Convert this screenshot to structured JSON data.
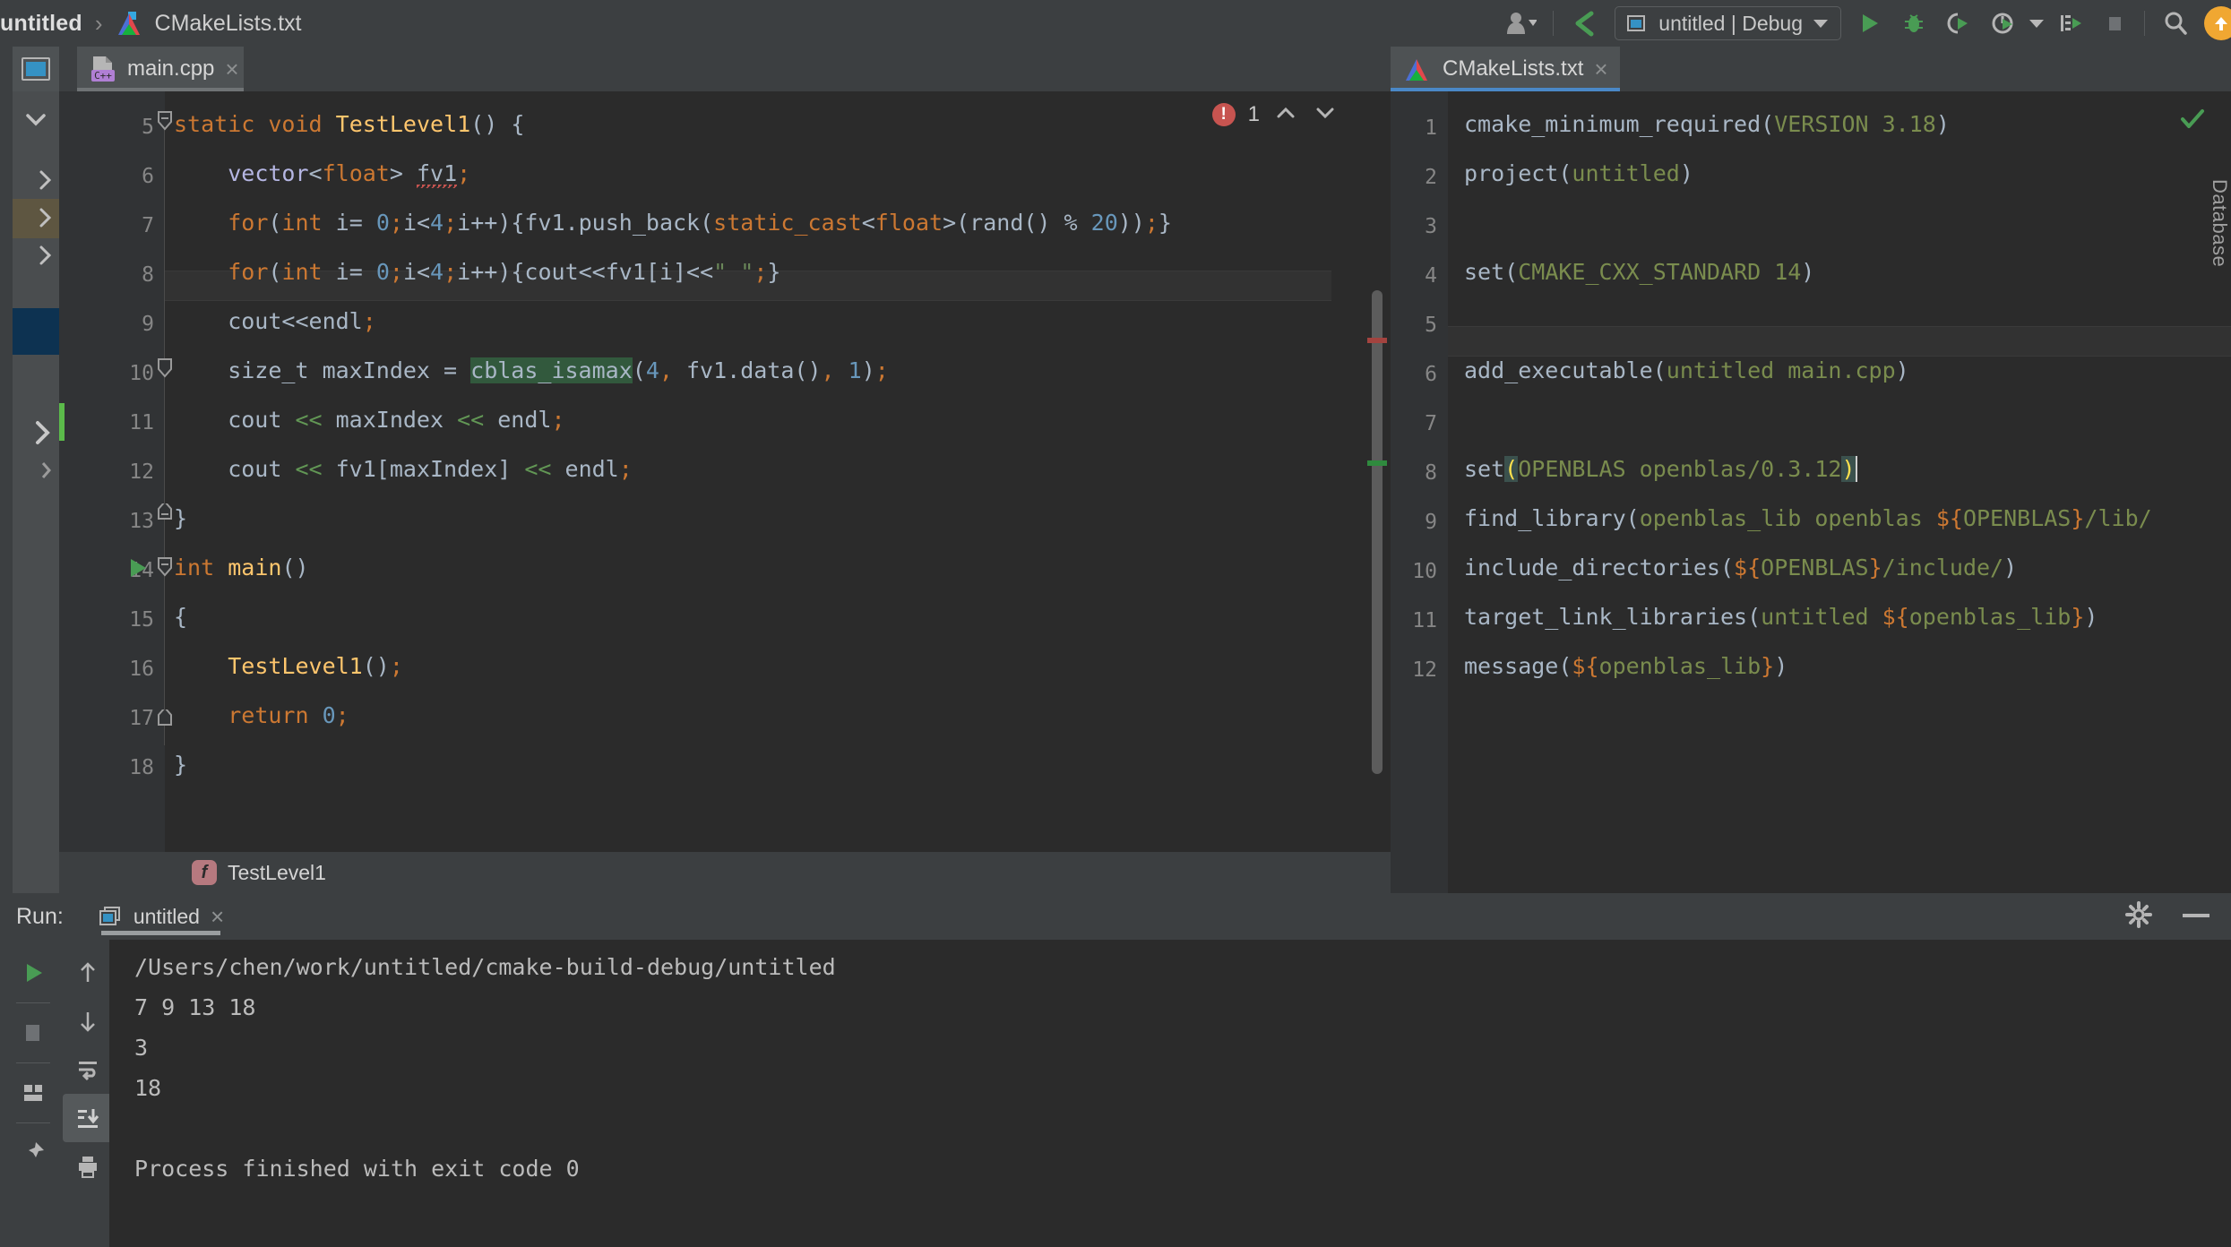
{
  "breadcrumb": {
    "project": "untitled",
    "separator": "›",
    "file": "CMakeLists.txt"
  },
  "toolbar": {
    "user_icon": "user-avatar-icon",
    "vcs_update_icon": "vcs-update-icon",
    "run_config": "untitled | Debug",
    "run_icon": "run-icon",
    "debug_icon": "debug-icon",
    "attach_icon": "attach-to-process-icon",
    "profile_icon": "profile-icon",
    "coverage_icon": "run-with-coverage-icon",
    "stop_icon": "stop-icon",
    "search_icon": "search-everywhere-icon",
    "update_badge_icon": "ide-update-icon"
  },
  "tabs": {
    "left": {
      "label": "main.cpp",
      "icon": "cpp-file-icon",
      "close": "×",
      "active": false
    },
    "right": {
      "label": "CMakeLists.txt",
      "icon": "cmake-file-icon",
      "close": "×",
      "active": true,
      "underline_color": "#4a88c7"
    }
  },
  "editor_cpp": {
    "line_numbers": [
      "5",
      "6",
      "7",
      "8",
      "9",
      "10",
      "11",
      "12",
      "13",
      "14",
      "15",
      "16",
      "17",
      "18"
    ],
    "inspection": {
      "error_icon": "error-icon",
      "error_count": "1",
      "prev_icon": "chevron-up-icon",
      "next_icon": "chevron-down-icon"
    },
    "lines": [
      {
        "n": "5",
        "text": "static void TestLevel1() {"
      },
      {
        "n": "6",
        "text": "    vector<float> fv1;"
      },
      {
        "n": "7",
        "text": "    for(int i= 0;i<4;i++){fv1.push_back(static_cast<float>(rand() % 20));}"
      },
      {
        "n": "8",
        "text": "    for(int i= 0;i<4;i++){cout<<fv1[i]<<\" \";}"
      },
      {
        "n": "9",
        "text": "    cout<<endl;"
      },
      {
        "n": "10",
        "text": "    size_t maxIndex = cblas_isamax(4, fv1.data(), 1);"
      },
      {
        "n": "11",
        "text": "    cout << maxIndex << endl;"
      },
      {
        "n": "12",
        "text": "    cout << fv1[maxIndex] << endl;"
      },
      {
        "n": "13",
        "text": "}"
      },
      {
        "n": "14",
        "text": "int main()"
      },
      {
        "n": "15",
        "text": "{"
      },
      {
        "n": "16",
        "text": "    TestLevel1();"
      },
      {
        "n": "17",
        "text": "    return 0;"
      },
      {
        "n": "18",
        "text": "}"
      }
    ],
    "gutter": {
      "run_arrow_icon": "run-gutter-icon",
      "fold_icon": "fold-collapse-icon"
    },
    "breadcrumb": {
      "badge": "f",
      "symbol": "TestLevel1"
    }
  },
  "editor_cmake": {
    "status_icon": "inspections-ok-icon",
    "line_numbers": [
      "1",
      "2",
      "3",
      "4",
      "5",
      "6",
      "7",
      "8",
      "9",
      "10",
      "11",
      "12"
    ],
    "lines": [
      {
        "n": "1",
        "cmd": "cmake_minimum_required",
        "args": "VERSION 3.18"
      },
      {
        "n": "2",
        "cmd": "project",
        "args": "untitled"
      },
      {
        "n": "3",
        "cmd": "",
        "args": ""
      },
      {
        "n": "4",
        "cmd": "set",
        "args": "CMAKE_CXX_STANDARD 14"
      },
      {
        "n": "5",
        "cmd": "",
        "args": ""
      },
      {
        "n": "6",
        "cmd": "add_executable",
        "args": "untitled main.cpp"
      },
      {
        "n": "7",
        "cmd": "",
        "args": ""
      },
      {
        "n": "8",
        "cmd": "set",
        "args": "OPENBLAS openblas/0.3.12"
      },
      {
        "n": "9",
        "cmd": "find_library",
        "args": "openblas_lib openblas ${OPENBLAS}/lib/"
      },
      {
        "n": "10",
        "cmd": "include_directories",
        "args": "${OPENBLAS}/include/"
      },
      {
        "n": "11",
        "cmd": "target_link_libraries",
        "args": "untitled ${openblas_lib}"
      },
      {
        "n": "12",
        "cmd": "message",
        "args": "${openblas_lib}"
      }
    ]
  },
  "run_panel": {
    "label": "Run:",
    "tab": {
      "label": "untitled",
      "icon": "run-config-icon",
      "close": "×"
    },
    "settings_icon": "gear-icon",
    "minimize_icon": "minimize-icon",
    "tools_left": [
      "rerun-icon",
      "stop-icon",
      "layout-icon",
      "pin-icon"
    ],
    "tools_right": [
      "scroll-up-icon",
      "scroll-down-icon",
      "soft-wrap-icon",
      "scroll-to-end-icon",
      "print-icon"
    ],
    "console": [
      "/Users/chen/work/untitled/cmake-build-debug/untitled",
      "7 9 13 18",
      "3",
      "18",
      "",
      "Process finished with exit code 0"
    ]
  },
  "right_tool_tab": "Database",
  "colors": {
    "bg_chrome": "#3c3f41",
    "bg_editor": "#2b2b2b",
    "gutter": "#313335",
    "accent_blue": "#4a88c7",
    "keyword": "#cc7832",
    "function": "#ffc66d",
    "number": "#6897bb",
    "string": "#6a8759",
    "cmake_arg": "#7a8c4e",
    "error": "#c75450",
    "ok_green": "#499c54"
  }
}
